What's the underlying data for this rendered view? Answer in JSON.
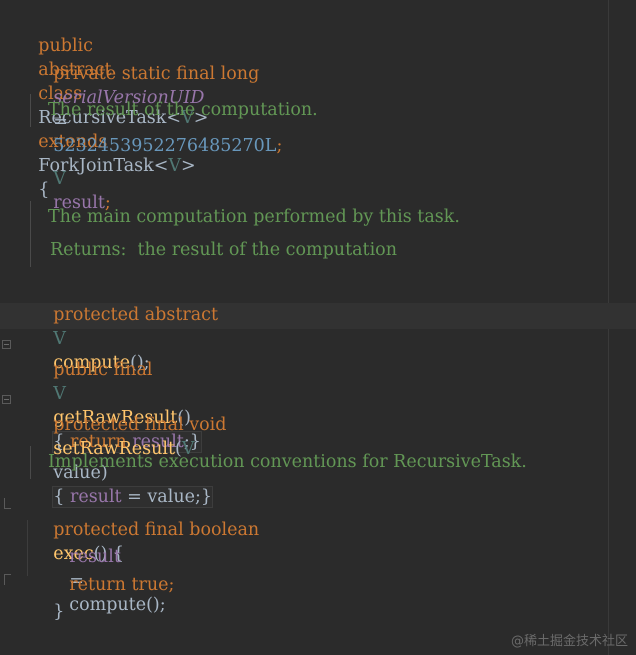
{
  "code": {
    "class_decl": {
      "public": "public",
      "abstract": "abstract",
      "class": "class",
      "name": "RecursiveTask",
      "type_param": "V",
      "extends": "extends",
      "super": "ForkJoinTask",
      "super_param": "V",
      "open": "{"
    },
    "serial": {
      "mods": "private static final long",
      "name": "serialVersionUID",
      "eq": "=",
      "value": "5232453952276485270L",
      "semi": ";"
    },
    "doc1": "The result of the computation.",
    "field_result": {
      "type": "V",
      "name": "result",
      "semi": ";"
    },
    "doc2": {
      "line1": "The main computation performed by this task.",
      "line2": "Returns:  the result of the computation"
    },
    "compute_decl": {
      "mods": "protected abstract",
      "type": "V",
      "name": "compute",
      "rest": "();"
    },
    "get_raw": {
      "mods": "public final",
      "type": "V",
      "name": "getRawResult",
      "parens": "()",
      "body_open": "{",
      "ret": "return",
      "field": "result",
      "body_close": ";}"
    },
    "set_raw": {
      "mods": "protected final void",
      "name": "setRawResult",
      "param_type": "V",
      "param_name": "value",
      "body_open": "{",
      "field": "result",
      "assign": "=",
      "value": "value",
      "body_close": ";}"
    },
    "doc3": "Implements execution conventions for RecursiveTask.",
    "exec_decl": {
      "mods": "protected final boolean",
      "name": "exec",
      "rest": "() {"
    },
    "exec_line1": {
      "field": "result",
      "eq": "=",
      "call": "compute",
      "rest": "();"
    },
    "exec_line2": {
      "ret": "return true",
      "semi": ";"
    },
    "exec_close": "}",
    "class_close": "}"
  },
  "watermark": "@稀土掘金技术社区",
  "colors": {
    "background": "#2b2b2b",
    "keyword": "#cc7832",
    "field": "#9876aa",
    "number": "#6897bb",
    "method": "#ffc66d",
    "doc": "#629755",
    "text": "#a9b7c6"
  }
}
